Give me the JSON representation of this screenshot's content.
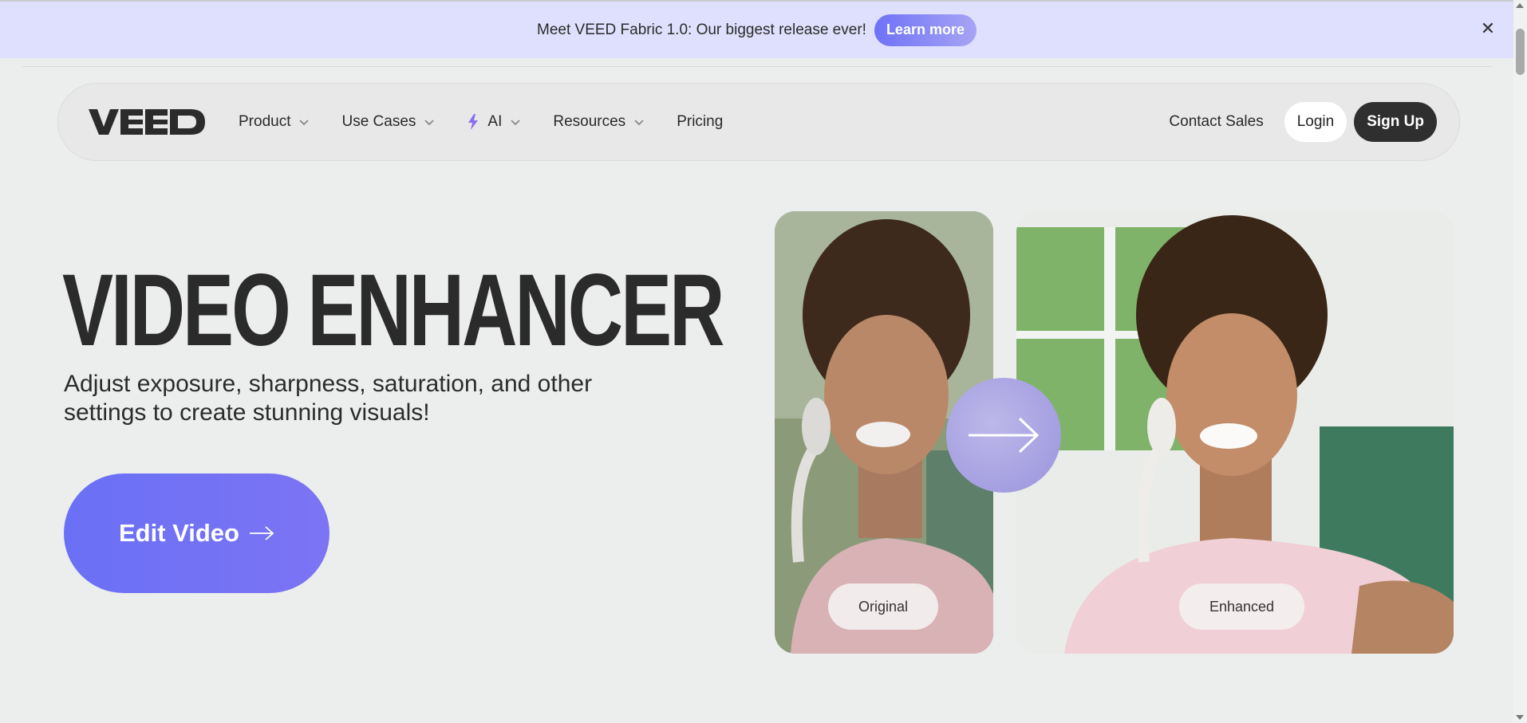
{
  "banner": {
    "text": "Meet VEED Fabric 1.0: Our biggest release ever!",
    "cta_label": "Learn more",
    "close_icon": "close-icon"
  },
  "nav": {
    "logo": "VEED",
    "items": [
      {
        "label": "Product",
        "has_dropdown": true
      },
      {
        "label": "Use Cases",
        "has_dropdown": true
      },
      {
        "label": "AI",
        "has_dropdown": true,
        "icon": "lightning-icon"
      },
      {
        "label": "Resources",
        "has_dropdown": true
      },
      {
        "label": "Pricing",
        "has_dropdown": false
      }
    ],
    "contact_label": "Contact Sales",
    "login_label": "Login",
    "signup_label": "Sign Up"
  },
  "hero": {
    "title": "VIDEO ENHANCER",
    "subtitle": "Adjust exposure, sharpness, saturation, and other settings to create stunning visuals!",
    "cta_label": "Edit Video"
  },
  "comparison": {
    "original_label": "Original",
    "enhanced_label": "Enhanced"
  },
  "colors": {
    "banner_bg": "#dfe0fd",
    "accent": "#6a70f5",
    "page_bg": "#eceeed",
    "dark_button": "#2f2f2f"
  }
}
